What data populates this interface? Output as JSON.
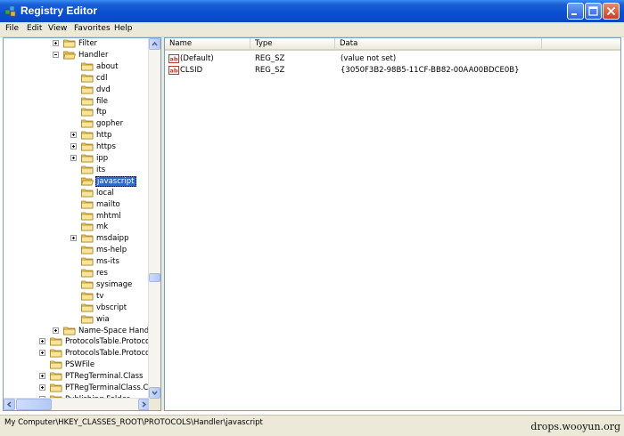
{
  "window": {
    "title": "Registry Editor"
  },
  "menu": [
    "File",
    "Edit",
    "View",
    "Favorites",
    "Help"
  ],
  "tree": [
    {
      "label": "Filter",
      "level": 2,
      "expander": "plus"
    },
    {
      "label": "Handler",
      "level": 2,
      "expander": "minus",
      "open": true
    },
    {
      "label": "about",
      "level": 3,
      "expander": "none"
    },
    {
      "label": "cdl",
      "level": 3,
      "expander": "none"
    },
    {
      "label": "dvd",
      "level": 3,
      "expander": "none"
    },
    {
      "label": "file",
      "level": 3,
      "expander": "none"
    },
    {
      "label": "ftp",
      "level": 3,
      "expander": "none"
    },
    {
      "label": "gopher",
      "level": 3,
      "expander": "none"
    },
    {
      "label": "http",
      "level": 3,
      "expander": "plus"
    },
    {
      "label": "https",
      "level": 3,
      "expander": "plus"
    },
    {
      "label": "ipp",
      "level": 3,
      "expander": "plus"
    },
    {
      "label": "its",
      "level": 3,
      "expander": "none"
    },
    {
      "label": "javascript",
      "level": 3,
      "expander": "none",
      "selected": true,
      "open": true
    },
    {
      "label": "local",
      "level": 3,
      "expander": "none"
    },
    {
      "label": "mailto",
      "level": 3,
      "expander": "none"
    },
    {
      "label": "mhtml",
      "level": 3,
      "expander": "none"
    },
    {
      "label": "mk",
      "level": 3,
      "expander": "none"
    },
    {
      "label": "msdaipp",
      "level": 3,
      "expander": "plus"
    },
    {
      "label": "ms-help",
      "level": 3,
      "expander": "none"
    },
    {
      "label": "ms-its",
      "level": 3,
      "expander": "none"
    },
    {
      "label": "res",
      "level": 3,
      "expander": "none"
    },
    {
      "label": "sysimage",
      "level": 3,
      "expander": "none"
    },
    {
      "label": "tv",
      "level": 3,
      "expander": "none"
    },
    {
      "label": "vbscript",
      "level": 3,
      "expander": "none"
    },
    {
      "label": "wia",
      "level": 3,
      "expander": "none"
    },
    {
      "label": "Name-Space Handle",
      "level": 2,
      "expander": "plus"
    },
    {
      "label": "ProtocolsTable.Protocol",
      "level": 0,
      "expander": "plus"
    },
    {
      "label": "ProtocolsTable.Protocol",
      "level": 0,
      "expander": "plus"
    },
    {
      "label": "PSWFile",
      "level": 0,
      "expander": "none"
    },
    {
      "label": "PTRegTerminal.Class",
      "level": 0,
      "expander": "plus"
    },
    {
      "label": "PTRegTerminalClass.Cla",
      "level": 0,
      "expander": "plus"
    },
    {
      "label": "Publishing Folder",
      "level": 0,
      "expander": "plus"
    }
  ],
  "columns": [
    "Name",
    "Type",
    "Data"
  ],
  "values": [
    {
      "name": "(Default)",
      "type": "REG_SZ",
      "data": "(value not set)"
    },
    {
      "name": "CLSID",
      "type": "REG_SZ",
      "data": "{3050F3B2-98B5-11CF-BB82-00AA00BDCE0B}"
    }
  ],
  "status": "My Computer\\HKEY_CLASSES_ROOT\\PROTOCOLS\\Handler\\javascript",
  "watermark": "drops.wooyun.org",
  "colors": {
    "titlebar": "#0a4ed1",
    "selection": "#316ac5",
    "folder": "#f5d76e"
  }
}
